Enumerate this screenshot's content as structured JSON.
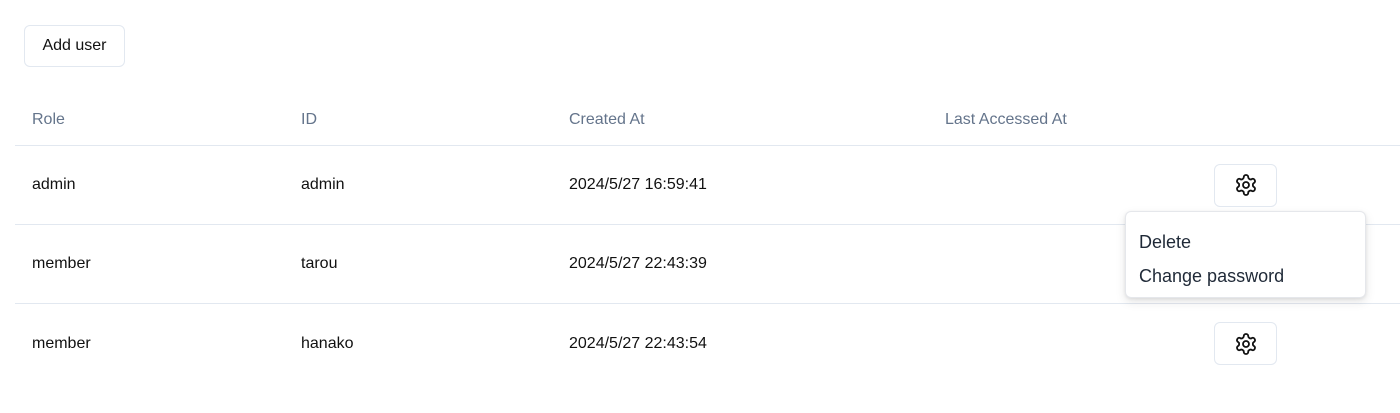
{
  "toolbar": {
    "add_user_label": "Add user"
  },
  "table": {
    "headers": {
      "role": "Role",
      "id": "ID",
      "created_at": "Created At",
      "last_accessed_at": "Last Accessed At"
    },
    "rows": [
      {
        "role": "admin",
        "id": "admin",
        "created_at": "2024/5/27 16:59:41",
        "last_accessed_at": ""
      },
      {
        "role": "member",
        "id": "tarou",
        "created_at": "2024/5/27 22:43:39",
        "last_accessed_at": ""
      },
      {
        "role": "member",
        "id": "hanako",
        "created_at": "2024/5/27 22:43:54",
        "last_accessed_at": ""
      }
    ]
  },
  "actions_menu": {
    "open_for_row": 1,
    "items": [
      {
        "label": "Delete"
      },
      {
        "label": "Change password"
      }
    ]
  },
  "icons": {
    "row_actions": "gear-icon"
  }
}
